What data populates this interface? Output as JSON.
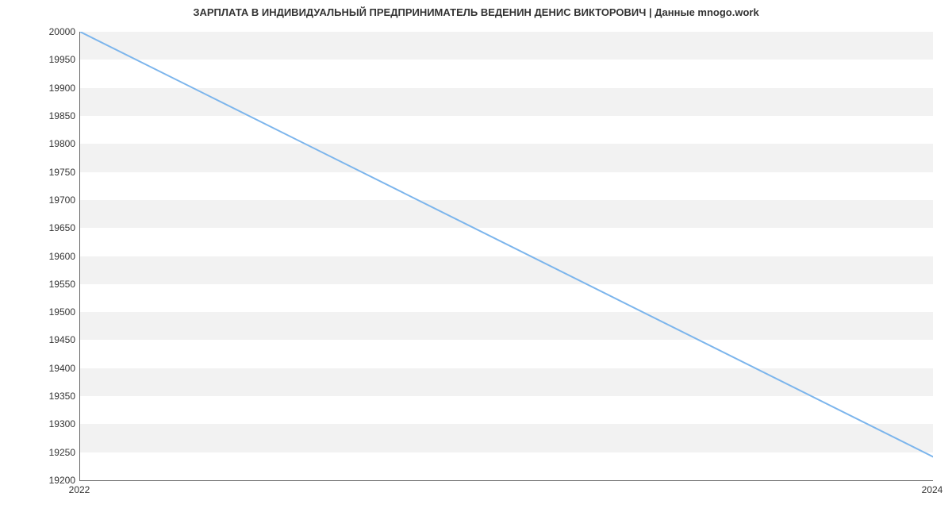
{
  "chart_data": {
    "type": "line",
    "title": "ЗАРПЛАТА В ИНДИВИДУАЛЬНЫЙ ПРЕДПРИНИМАТЕЛЬ ВЕДЕНИН ДЕНИС ВИКТОРОВИЧ | Данные mnogo.work",
    "xlabel": "",
    "ylabel": "",
    "x": [
      2022,
      2024
    ],
    "values": [
      20000,
      19242
    ],
    "x_ticks": [
      2022,
      2024
    ],
    "y_ticks": [
      19200,
      19250,
      19300,
      19350,
      19400,
      19450,
      19500,
      19550,
      19600,
      19650,
      19700,
      19750,
      19800,
      19850,
      19900,
      19950,
      20000
    ],
    "xlim": [
      2022,
      2024
    ],
    "ylim": [
      19200,
      20000
    ],
    "line_color": "#7cb5ec",
    "grid": "banded"
  }
}
